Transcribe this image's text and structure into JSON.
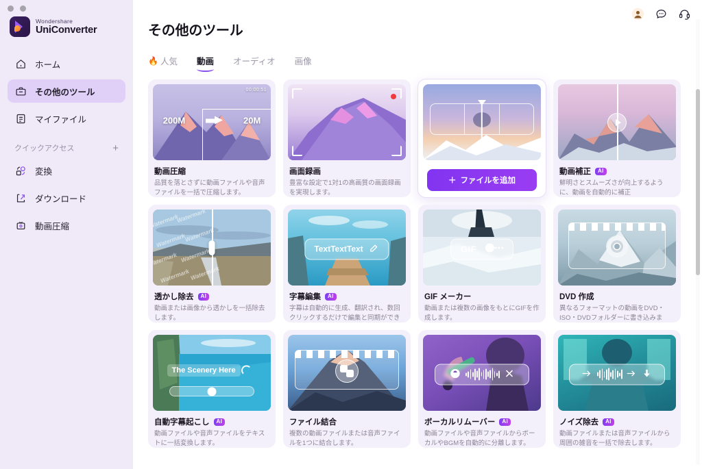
{
  "brand": {
    "top": "Wondershare",
    "bottom": "UniConverter"
  },
  "sidebar": {
    "items": [
      {
        "label": "ホーム",
        "icon": "home-icon",
        "active": false
      },
      {
        "label": "その他のツール",
        "icon": "toolbox-icon",
        "active": true
      },
      {
        "label": "マイファイル",
        "icon": "file-icon",
        "active": false
      }
    ],
    "quick_access": {
      "title": "クイックアクセス",
      "add_label": "+",
      "items": [
        {
          "label": "変換",
          "icon": "convert-icon"
        },
        {
          "label": "ダウンロード",
          "icon": "download-icon"
        },
        {
          "label": "動画圧縮",
          "icon": "compress-icon"
        }
      ]
    }
  },
  "topbar": {
    "icons": [
      {
        "name": "user-avatar-icon"
      },
      {
        "name": "chat-bubble-icon"
      },
      {
        "name": "headset-support-icon"
      }
    ]
  },
  "main": {
    "page_title": "その他のツール",
    "tabs": [
      {
        "label": "人気",
        "icon": "flame-icon",
        "active": false
      },
      {
        "label": "動画",
        "icon": "",
        "active": true
      },
      {
        "label": "オーディオ",
        "icon": "",
        "active": false
      },
      {
        "label": "画像",
        "icon": "",
        "active": false
      }
    ],
    "add_file_button": "ファイルを追加",
    "cards": [
      {
        "id": "video-compress",
        "title": "動画圧縮",
        "ai": false,
        "desc": "品質を落とさずに動画ファイルや音声ファイルを一括で圧縮します。",
        "hovered": false,
        "art": {
          "kind": "compress",
          "from": "200M",
          "to": "20M",
          "time": "00:00:51"
        }
      },
      {
        "id": "screen-record",
        "title": "画面録画",
        "ai": false,
        "desc": "豊富な設定で1対1の高画質の画面録画を実現します。",
        "hovered": false,
        "art": {
          "kind": "record"
        }
      },
      {
        "id": "video-trim",
        "title": "",
        "ai": false,
        "desc": "",
        "hovered": true,
        "art": {
          "kind": "trim"
        }
      },
      {
        "id": "video-enhance",
        "title": "動画補正",
        "ai": true,
        "desc": "鮮明さとスムーズさが向上するように、動画を自動的に補正",
        "hovered": false,
        "art": {
          "kind": "enhance"
        }
      },
      {
        "id": "watermark-remove",
        "title": "透かし除去",
        "ai": true,
        "desc": "動画または画像から透かしを一括除去します。",
        "hovered": false,
        "art": {
          "kind": "watermark",
          "text": "Watermark"
        }
      },
      {
        "id": "subtitle-edit",
        "title": "字幕編集",
        "ai": true,
        "desc": "字幕は自動的に生成、翻訳され、数回クリックするだけで編集と同期ができます。",
        "hovered": false,
        "art": {
          "kind": "subtitle",
          "label": "TextTextText"
        }
      },
      {
        "id": "gif-maker",
        "title": "GIF メーカー",
        "ai": false,
        "desc": "動画または複数の画像をもとにGIFを作成します。",
        "hovered": false,
        "art": {
          "kind": "gif",
          "label": "GIF"
        }
      },
      {
        "id": "dvd-burn",
        "title": "DVD 作成",
        "ai": false,
        "desc": "異なるフォーマットの動画をDVD・ISO・DVDフォルダーに書き込みます。",
        "hovered": false,
        "art": {
          "kind": "dvd"
        }
      },
      {
        "id": "auto-transcribe",
        "title": "自動字幕起こし",
        "ai": true,
        "desc": "動画ファイルや音声ファイルをテキストに一括変換します。",
        "hovered": false,
        "art": {
          "kind": "transcribe",
          "label": "The Scenery Here"
        }
      },
      {
        "id": "file-merge",
        "title": "ファイル結合",
        "ai": false,
        "desc": "複数の動画ファイルまたは音声ファイルを1つに結合します。",
        "hovered": false,
        "art": {
          "kind": "merge"
        }
      },
      {
        "id": "vocal-remover",
        "title": "ボーカルリムーバー",
        "ai": true,
        "desc": "動画ファイルや音声ファイルからボーカルやBGMを自動的に分離します。",
        "hovered": false,
        "art": {
          "kind": "vocal"
        }
      },
      {
        "id": "noise-remove",
        "title": "ノイズ除去",
        "ai": true,
        "desc": "動画ファイルまたは音声ファイルから周囲の雑音を一括で除去します。",
        "hovered": false,
        "art": {
          "kind": "noise"
        }
      }
    ]
  },
  "colors": {
    "sidebar_bg": "#efe9f8",
    "active_nav": "#e0d0f7",
    "accent": "#8b4ff0",
    "card_bg": "#f4f0fb",
    "ai_badge_from": "#7b3ff0",
    "ai_badge_to": "#c341e8"
  }
}
